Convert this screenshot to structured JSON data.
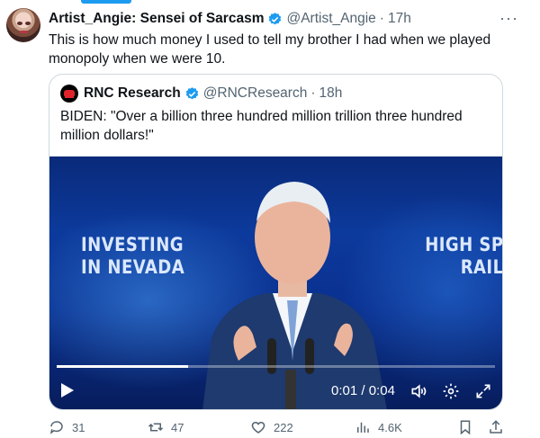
{
  "tweet": {
    "author_name": "Artist_Angie: Sensei of Sarcasm",
    "handle": "@Artist_Angie",
    "separator": "·",
    "time": "17h",
    "more_label": "···",
    "text": "This is how much money I used to tell my brother I had when we played monopoly when we were 10."
  },
  "quote": {
    "author_name": "RNC Research",
    "handle": "@RNCResearch",
    "separator": "·",
    "time": "18h",
    "text": "BIDEN: \"Over a billion three hundred million trillion three hundred million dollars!\""
  },
  "video": {
    "sign_left": [
      "INVESTING",
      "IN NEVADA"
    ],
    "sign_right": [
      "HIGH SP",
      "RAIL"
    ],
    "current_time": "0:01",
    "time_sep": " / ",
    "duration": "0:04",
    "progress": 0.3
  },
  "actions": {
    "replies": "31",
    "reposts": "47",
    "likes": "222",
    "views": "4.6K"
  },
  "colors": {
    "accent": "#1d9bf0",
    "muted": "#536471",
    "rnc_red": "#e0242b"
  }
}
